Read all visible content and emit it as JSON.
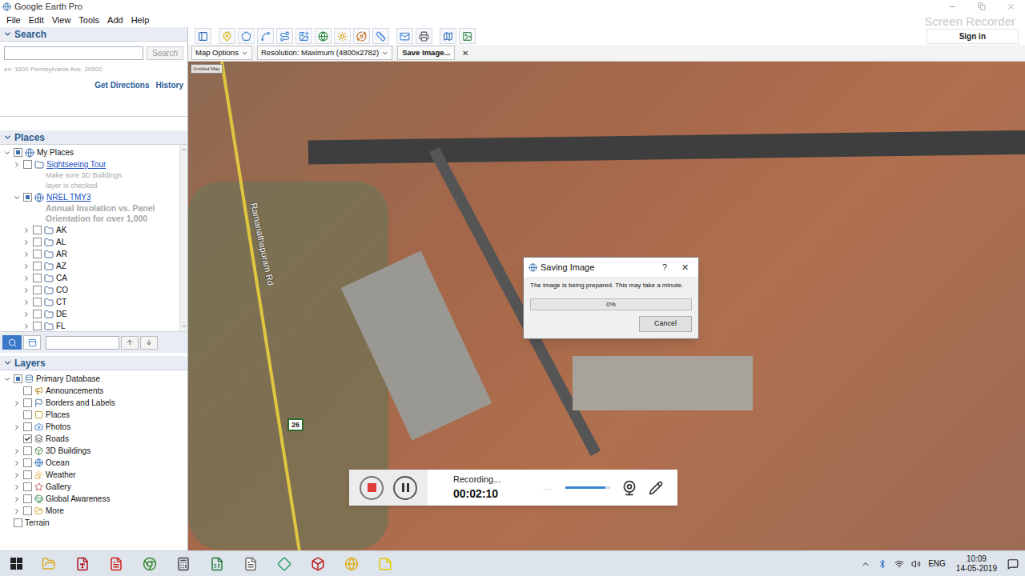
{
  "window": {
    "title": "Google Earth Pro",
    "sign_in": "Sign in",
    "watermark": "Screen Recorder"
  },
  "menu": [
    "File",
    "Edit",
    "View",
    "Tools",
    "Add",
    "Help"
  ],
  "save_bar": {
    "map_options": "Map Options",
    "resolution": "Resolution: Maximum (4800x2782)",
    "save": "Save Image...",
    "close": "✕"
  },
  "search": {
    "header": "Search",
    "expanded": true,
    "placeholder": "",
    "button": "Search",
    "hint": "ex: 1600 Pennsylvania Ave, 20500",
    "links": [
      "Get Directions",
      "History"
    ]
  },
  "places": {
    "header": "Places",
    "expanded": true,
    "items": [
      {
        "label": "My Places",
        "level": 0,
        "expandable": true,
        "expanded": true,
        "checked": false,
        "partial": true,
        "link": false,
        "kind": "globe",
        "description": []
      },
      {
        "label": "Sightseeing Tour",
        "level": 1,
        "expandable": true,
        "expanded": false,
        "checked": false,
        "partial": false,
        "link": true,
        "kind": "folder",
        "description": [
          "Make sure 3D Buildings",
          "layer is checked"
        ]
      },
      {
        "label": "NREL TMY3",
        "level": 1,
        "expandable": true,
        "expanded": true,
        "checked": false,
        "partial": true,
        "link": true,
        "kind": "globe",
        "description": [
          "Annual Insolation vs. Panel",
          "Orientation for over 1,000"
        ]
      },
      {
        "label": "AK",
        "level": 2,
        "expandable": true,
        "expanded": false,
        "checked": false,
        "partial": false,
        "link": false,
        "kind": "folder",
        "description": []
      },
      {
        "label": "AL",
        "level": 2,
        "expandable": true,
        "expanded": false,
        "checked": false,
        "partial": false,
        "link": false,
        "kind": "folder",
        "description": []
      },
      {
        "label": "AR",
        "level": 2,
        "expandable": true,
        "expanded": false,
        "checked": false,
        "partial": false,
        "link": false,
        "kind": "folder",
        "description": []
      },
      {
        "label": "AZ",
        "level": 2,
        "expandable": true,
        "expanded": false,
        "checked": false,
        "partial": false,
        "link": false,
        "kind": "folder",
        "description": []
      },
      {
        "label": "CA",
        "level": 2,
        "expandable": true,
        "expanded": false,
        "checked": false,
        "partial": false,
        "link": false,
        "kind": "folder",
        "description": []
      },
      {
        "label": "CO",
        "level": 2,
        "expandable": true,
        "expanded": false,
        "checked": false,
        "partial": false,
        "link": false,
        "kind": "folder",
        "description": []
      },
      {
        "label": "CT",
        "level": 2,
        "expandable": true,
        "expanded": false,
        "checked": false,
        "partial": false,
        "link": false,
        "kind": "folder",
        "description": []
      },
      {
        "label": "DE",
        "level": 2,
        "expandable": true,
        "expanded": false,
        "checked": false,
        "partial": false,
        "link": false,
        "kind": "folder",
        "description": []
      },
      {
        "label": "FL",
        "level": 2,
        "expandable": true,
        "expanded": false,
        "checked": false,
        "partial": false,
        "link": false,
        "kind": "folder",
        "description": []
      }
    ]
  },
  "layers": {
    "header": "Layers",
    "expanded": true,
    "items": [
      {
        "label": "Primary Database",
        "level": 0,
        "expandable": true,
        "expanded": true,
        "checked": false,
        "partial": true
      },
      {
        "label": "Announcements",
        "level": 1,
        "expandable": false,
        "expanded": false,
        "checked": false,
        "partial": false
      },
      {
        "label": "Borders and Labels",
        "level": 1,
        "expandable": true,
        "expanded": false,
        "checked": false,
        "partial": false
      },
      {
        "label": "Places",
        "level": 1,
        "expandable": false,
        "expanded": false,
        "checked": false,
        "partial": false
      },
      {
        "label": "Photos",
        "level": 1,
        "expandable": true,
        "expanded": false,
        "checked": false,
        "partial": false
      },
      {
        "label": "Roads",
        "level": 1,
        "expandable": false,
        "expanded": false,
        "checked": true,
        "partial": false
      },
      {
        "label": "3D Buildings",
        "level": 1,
        "expandable": true,
        "expanded": false,
        "checked": false,
        "partial": false
      },
      {
        "label": "Ocean",
        "level": 1,
        "expandable": true,
        "expanded": false,
        "checked": false,
        "partial": false
      },
      {
        "label": "Weather",
        "level": 1,
        "expandable": true,
        "expanded": false,
        "checked": false,
        "partial": false
      },
      {
        "label": "Gallery",
        "level": 1,
        "expandable": true,
        "expanded": false,
        "checked": false,
        "partial": false
      },
      {
        "label": "Global Awareness",
        "level": 1,
        "expandable": true,
        "expanded": false,
        "checked": false,
        "partial": false
      },
      {
        "label": "More",
        "level": 1,
        "expandable": true,
        "expanded": false,
        "checked": false,
        "partial": false
      },
      {
        "label": "Terrain",
        "level": 0,
        "expandable": false,
        "expanded": false,
        "checked": false,
        "partial": false
      }
    ]
  },
  "map": {
    "legend": "Untitled Map",
    "road_label": "Ramanathapuram Rd",
    "road_shield": "26"
  },
  "dialog": {
    "title": "Saving Image",
    "help": "?",
    "close": "✕",
    "message": "The image is being prepared. This may take a minute.",
    "level": 0,
    "progress_text": "0%",
    "button": "Cancel"
  },
  "recorder": {
    "status": "Recording...",
    "time": "00:02:10",
    "dots": "....",
    "volume": 0.9
  },
  "taskbar": {
    "language": "ENG",
    "time": "10:09",
    "date": "14-05-2019"
  }
}
